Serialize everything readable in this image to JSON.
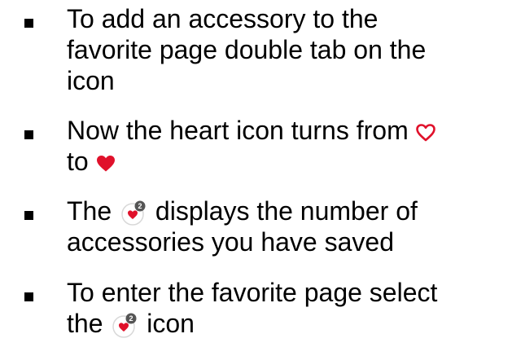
{
  "bullets": [
    {
      "lines": [
        "To add an accessory to the",
        "favorite page double tab on the",
        "icon"
      ]
    },
    {
      "line1_before": "Now the heart icon turns from",
      "line2_before": "to"
    },
    {
      "line1_before": "The",
      "line1_after": "displays the number of",
      "line2": "accessories you have saved"
    },
    {
      "line1": "To enter the favorite page select",
      "line2_before": "the",
      "line2_after": "icon"
    }
  ],
  "favorites_badge_count": "2",
  "icons": {
    "heart_outline": "heart-outline-icon",
    "heart_filled": "heart-filled-icon",
    "favorites_button": "favorites-badge-icon"
  },
  "colors": {
    "heart": "#e0112b",
    "badge": "#555555",
    "button_ring": "#d8d8d8"
  }
}
